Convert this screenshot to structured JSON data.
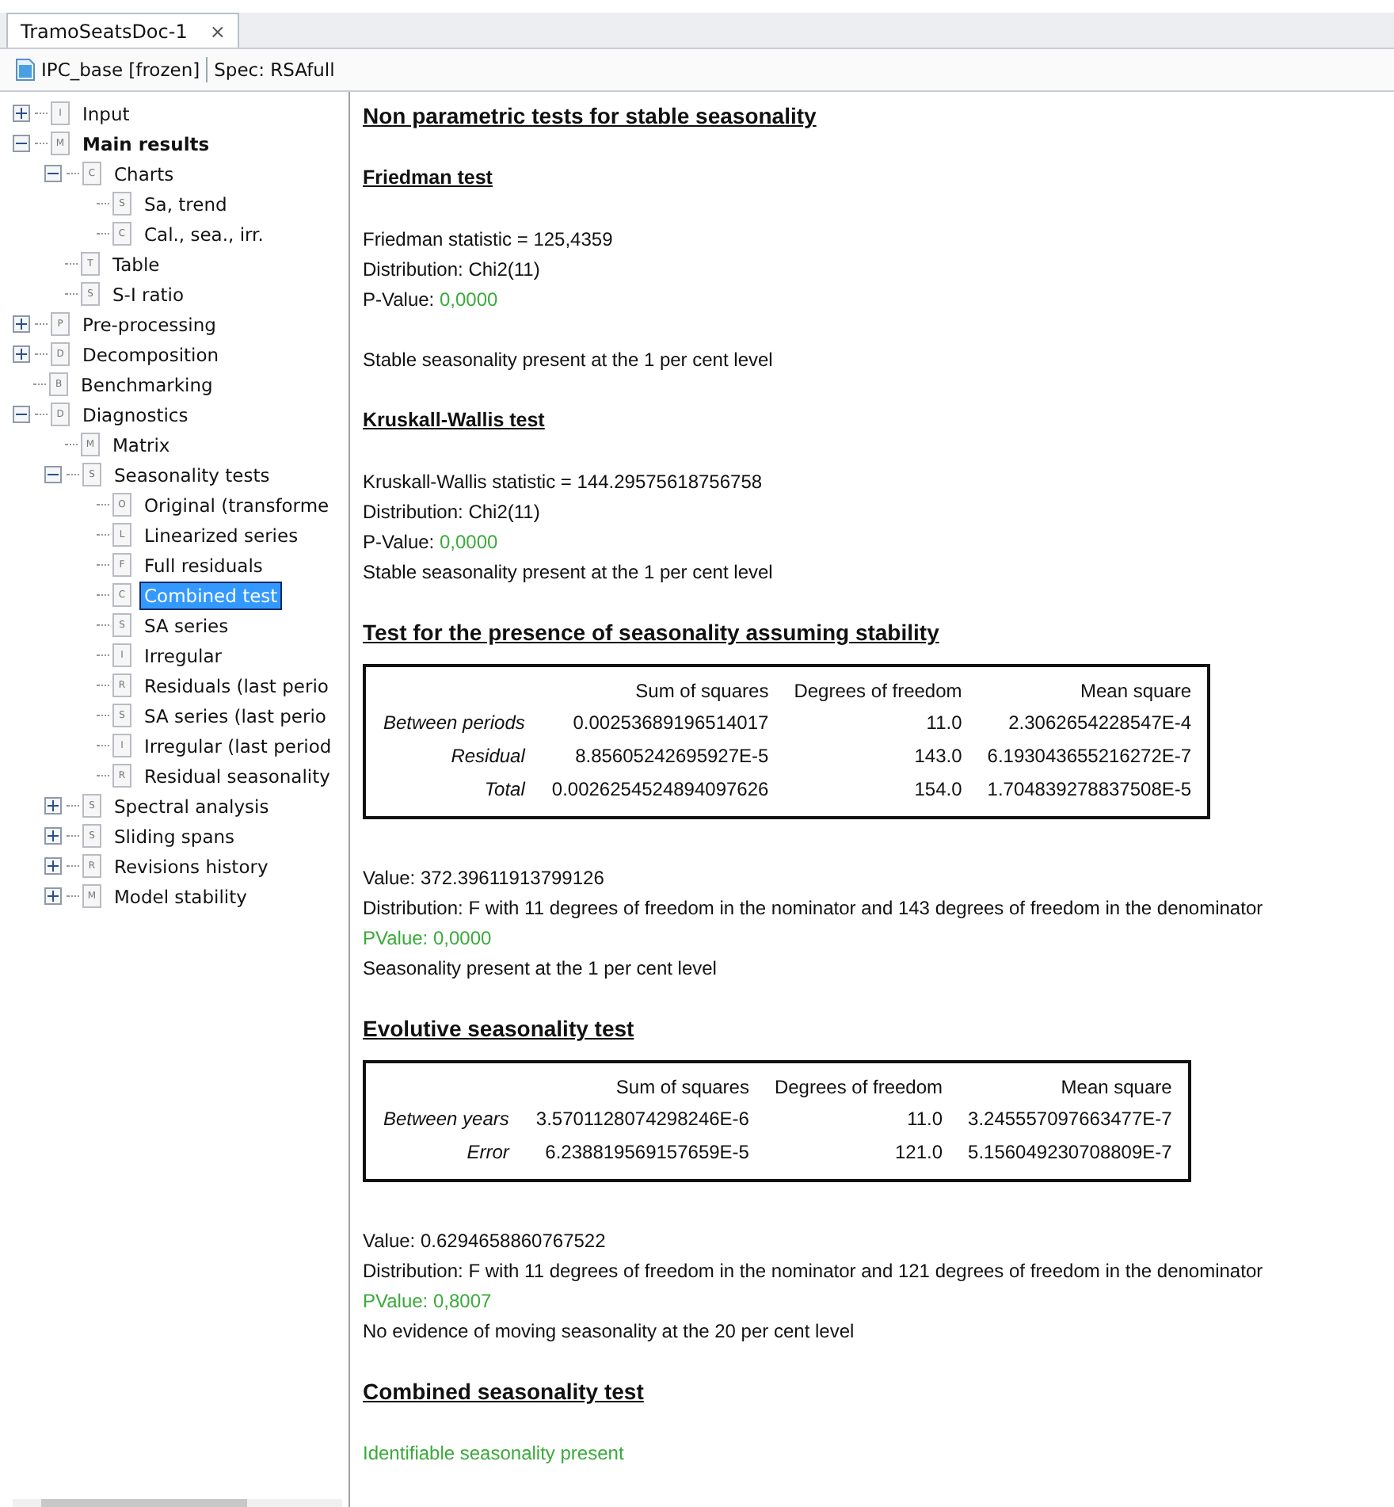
{
  "tab": {
    "title": "TramoSeatsDoc-1",
    "close": "×",
    "selected": true
  },
  "toolbar": {
    "document": "IPC_base [frozen]",
    "spec": "Spec: RSAfull"
  },
  "tree": [
    {
      "label": "Input",
      "badge": "I",
      "expanded": false,
      "bold": false,
      "selected": false
    },
    {
      "label": "Main results",
      "badge": "M",
      "expanded": true,
      "bold": true,
      "selected": false,
      "children": [
        {
          "label": "Charts",
          "badge": "C",
          "expanded": true,
          "bold": false,
          "selected": false,
          "children": [
            {
              "label": "Sa, trend",
              "badge": "S",
              "bold": false,
              "selected": false
            },
            {
              "label": "Cal., sea., irr.",
              "badge": "C",
              "bold": false,
              "selected": false
            }
          ]
        },
        {
          "label": "Table",
          "badge": "T",
          "bold": false,
          "selected": false
        },
        {
          "label": "S-I ratio",
          "badge": "S",
          "bold": false,
          "selected": false
        }
      ]
    },
    {
      "label": "Pre-processing",
      "badge": "P",
      "expanded": false,
      "bold": false,
      "selected": false
    },
    {
      "label": "Decomposition",
      "badge": "D",
      "expanded": false,
      "bold": false,
      "selected": false
    },
    {
      "label": "Benchmarking",
      "badge": "B",
      "bold": false,
      "selected": false
    },
    {
      "label": "Diagnostics",
      "badge": "D",
      "expanded": true,
      "bold": false,
      "selected": false,
      "children": [
        {
          "label": "Matrix",
          "badge": "M",
          "bold": false,
          "selected": false
        },
        {
          "label": "Seasonality tests",
          "badge": "S",
          "expanded": true,
          "bold": false,
          "selected": false,
          "children": [
            {
              "label": "Original (transforme",
              "badge": "O",
              "bold": false,
              "selected": false
            },
            {
              "label": "Linearized series",
              "badge": "L",
              "bold": false,
              "selected": false
            },
            {
              "label": "Full residuals",
              "badge": "F",
              "bold": false,
              "selected": false
            },
            {
              "label": "Combined test",
              "badge": "C",
              "bold": false,
              "selected": true
            },
            {
              "label": "SA series",
              "badge": "S",
              "bold": false,
              "selected": false
            },
            {
              "label": "Irregular",
              "badge": "I",
              "bold": false,
              "selected": false
            },
            {
              "label": "Residuals (last perio",
              "badge": "R",
              "bold": false,
              "selected": false
            },
            {
              "label": "SA series (last perio",
              "badge": "S",
              "bold": false,
              "selected": false
            },
            {
              "label": "Irregular (last period",
              "badge": "I",
              "bold": false,
              "selected": false
            },
            {
              "label": "Residual seasonality",
              "badge": "R",
              "bold": false,
              "selected": false
            }
          ]
        },
        {
          "label": "Spectral analysis",
          "badge": "S",
          "expanded": false,
          "bold": false,
          "selected": false
        },
        {
          "label": "Sliding spans",
          "badge": "S",
          "expanded": false,
          "bold": false,
          "selected": false
        },
        {
          "label": "Revisions history",
          "badge": "R",
          "expanded": false,
          "bold": false,
          "selected": false
        },
        {
          "label": "Model stability",
          "badge": "M",
          "expanded": false,
          "bold": false,
          "selected": false
        }
      ]
    }
  ],
  "report": [
    {
      "kind": "title",
      "text": "Non parametric tests for stable seasonality"
    },
    {
      "kind": "subtitle",
      "text": "Friedman test"
    },
    {
      "kind": "para",
      "lines": [
        {
          "text": "Friedman statistic = 125,4359",
          "highlight": false
        },
        {
          "text": "Distribution: Chi2(11)",
          "highlight": false
        },
        {
          "text": "P-Value: ",
          "value": "0,0000",
          "highlight": false
        }
      ]
    },
    {
      "kind": "para",
      "lines": [
        {
          "text": "Stable seasonality present at the 1 per cent level",
          "highlight": false
        }
      ]
    },
    {
      "kind": "subtitle",
      "text": "Kruskall-Wallis test"
    },
    {
      "kind": "para",
      "lines": [
        {
          "text": "Kruskall-Wallis statistic = 144.29575618756758",
          "highlight": false
        },
        {
          "text": "Distribution: Chi2(11)",
          "highlight": false
        },
        {
          "text": "P-Value: ",
          "value": "0,0000",
          "highlight": false
        },
        {
          "text": "Stable seasonality present at the 1 per cent level",
          "highlight": false
        }
      ]
    },
    {
      "kind": "title",
      "text": "Test for the presence of seasonality assuming stability"
    },
    {
      "kind": "table",
      "columns": [
        "Sum of squares",
        "Degrees of freedom",
        "Mean square"
      ],
      "rows": [
        {
          "label": "Between periods",
          "cells": [
            "0.00253689196514017",
            "11.0",
            "2.3062654228547E-4"
          ]
        },
        {
          "label": "Residual",
          "cells": [
            "8.85605242695927E-5",
            "143.0",
            "6.193043655216272E-7"
          ]
        },
        {
          "label": "Total",
          "cells": [
            "0.0026254524894097626",
            "154.0",
            "1.704839278837508E-5"
          ]
        }
      ]
    },
    {
      "kind": "para",
      "lines": [
        {
          "text": "Value: 372.39611913799126",
          "highlight": false
        },
        {
          "text": "Distribution: F with 11 degrees of freedom in the nominator and 143 degrees of freedom in the denominator",
          "highlight": false
        },
        {
          "text": "PValue: 0,0000",
          "highlight": true
        },
        {
          "text": "Seasonality present at the 1 per cent level",
          "highlight": false
        }
      ]
    },
    {
      "kind": "title",
      "text": "Evolutive seasonality test"
    },
    {
      "kind": "table",
      "columns": [
        "Sum of squares",
        "Degrees of freedom",
        "Mean square"
      ],
      "rows": [
        {
          "label": "Between years",
          "cells": [
            "3.5701128074298246E-6",
            "11.0",
            "3.245557097663477E-7"
          ]
        },
        {
          "label": "Error",
          "cells": [
            "6.238819569157659E-5",
            "121.0",
            "5.156049230708809E-7"
          ]
        }
      ]
    },
    {
      "kind": "para",
      "lines": [
        {
          "text": "Value: 0.6294658860767522",
          "highlight": false
        },
        {
          "text": "Distribution: F with 11 degrees of freedom in the nominator and 121 degrees of freedom in the denominator",
          "highlight": false
        },
        {
          "text": "PValue: 0,8007",
          "highlight": true
        },
        {
          "text": "No evidence of moving seasonality at the 20 per cent level",
          "highlight": false
        }
      ]
    },
    {
      "kind": "title",
      "text": "Combined seasonality test"
    },
    {
      "kind": "para",
      "lines": [
        {
          "text": "Identifiable seasonality present",
          "highlight": true
        }
      ]
    }
  ]
}
